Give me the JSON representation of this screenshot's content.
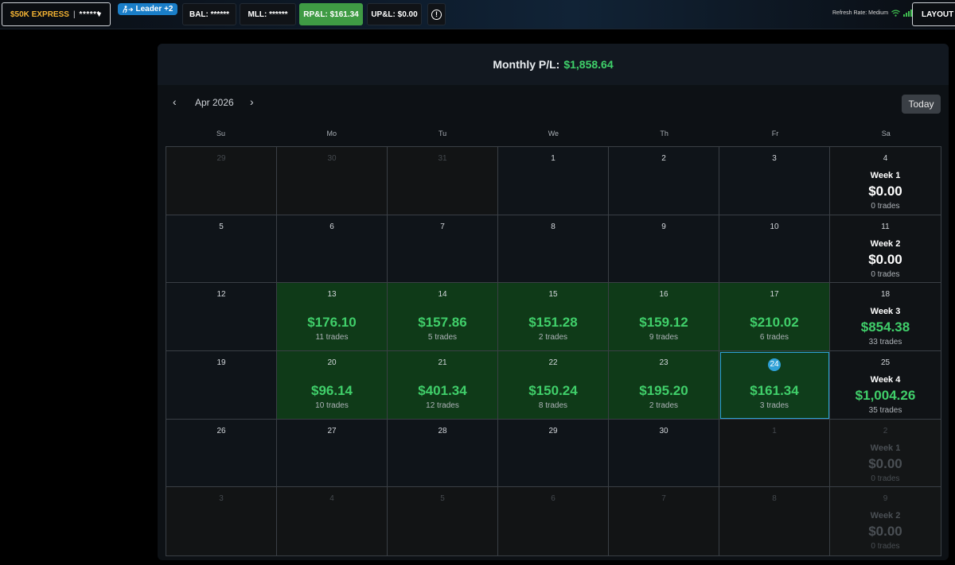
{
  "topbar": {
    "account_name": "$50K EXPRESS",
    "account_sep": "|",
    "account_mask": "******",
    "leader": "Leader +2",
    "bal": "BAL: ******",
    "mll": "MLL: ******",
    "rpl": "RP&L: $161.34",
    "upl": "UP&L: $0.00",
    "info_glyph": "!",
    "refresh_rate": "Refresh Rate: Medium",
    "layout": "LAYOUT | ©",
    "colors": {
      "accent_orange": "#f2b233",
      "leader_blue": "#1a7ec8",
      "rpl_green": "#3f9b44"
    }
  },
  "summary": {
    "label": "Monthly P/L:",
    "value": "$1,858.64"
  },
  "calendar": {
    "month": "Apr 2026",
    "prev": "‹",
    "next": "›",
    "today_label": "Today",
    "weekdays": [
      "Su",
      "Mo",
      "Tu",
      "We",
      "Th",
      "Fr",
      "Sa"
    ],
    "rows": [
      [
        {
          "day": "29",
          "out": true
        },
        {
          "day": "30",
          "out": true
        },
        {
          "day": "31",
          "out": true
        },
        {
          "day": "1"
        },
        {
          "day": "2"
        },
        {
          "day": "3"
        },
        {
          "day": "4",
          "week": "Week 1",
          "week_amount": "$0.00",
          "week_trades": "0 trades"
        }
      ],
      [
        {
          "day": "5"
        },
        {
          "day": "6"
        },
        {
          "day": "7"
        },
        {
          "day": "8"
        },
        {
          "day": "9"
        },
        {
          "day": "10"
        },
        {
          "day": "11",
          "week": "Week 2",
          "week_amount": "$0.00",
          "week_trades": "0 trades"
        }
      ],
      [
        {
          "day": "12"
        },
        {
          "day": "13",
          "amount": "$176.10",
          "trades": "11 trades"
        },
        {
          "day": "14",
          "amount": "$157.86",
          "trades": "5 trades"
        },
        {
          "day": "15",
          "amount": "$151.28",
          "trades": "2 trades"
        },
        {
          "day": "16",
          "amount": "$159.12",
          "trades": "9 trades"
        },
        {
          "day": "17",
          "amount": "$210.02",
          "trades": "6 trades"
        },
        {
          "day": "18",
          "week": "Week 3",
          "week_amount": "$854.38",
          "week_trades": "33 trades",
          "positive": true
        }
      ],
      [
        {
          "day": "19"
        },
        {
          "day": "20",
          "amount": "$96.14",
          "trades": "10 trades"
        },
        {
          "day": "21",
          "amount": "$401.34",
          "trades": "12 trades"
        },
        {
          "day": "22",
          "amount": "$150.24",
          "trades": "8 trades"
        },
        {
          "day": "23",
          "amount": "$195.20",
          "trades": "2 trades"
        },
        {
          "day": "24",
          "amount": "$161.34",
          "trades": "3 trades",
          "today": true
        },
        {
          "day": "25",
          "week": "Week 4",
          "week_amount": "$1,004.26",
          "week_trades": "35 trades",
          "positive": true
        }
      ],
      [
        {
          "day": "26"
        },
        {
          "day": "27"
        },
        {
          "day": "28"
        },
        {
          "day": "29"
        },
        {
          "day": "30"
        },
        {
          "day": "1",
          "out": true
        },
        {
          "day": "2",
          "out": true,
          "week": "Week 1",
          "week_amount": "$0.00",
          "week_trades": "0 trades"
        }
      ],
      [
        {
          "day": "3",
          "out": true
        },
        {
          "day": "4",
          "out": true
        },
        {
          "day": "5",
          "out": true
        },
        {
          "day": "6",
          "out": true
        },
        {
          "day": "7",
          "out": true
        },
        {
          "day": "8",
          "out": true
        },
        {
          "day": "9",
          "out": true,
          "week": "Week 2",
          "week_amount": "$0.00",
          "week_trades": "0 trades"
        }
      ]
    ]
  }
}
